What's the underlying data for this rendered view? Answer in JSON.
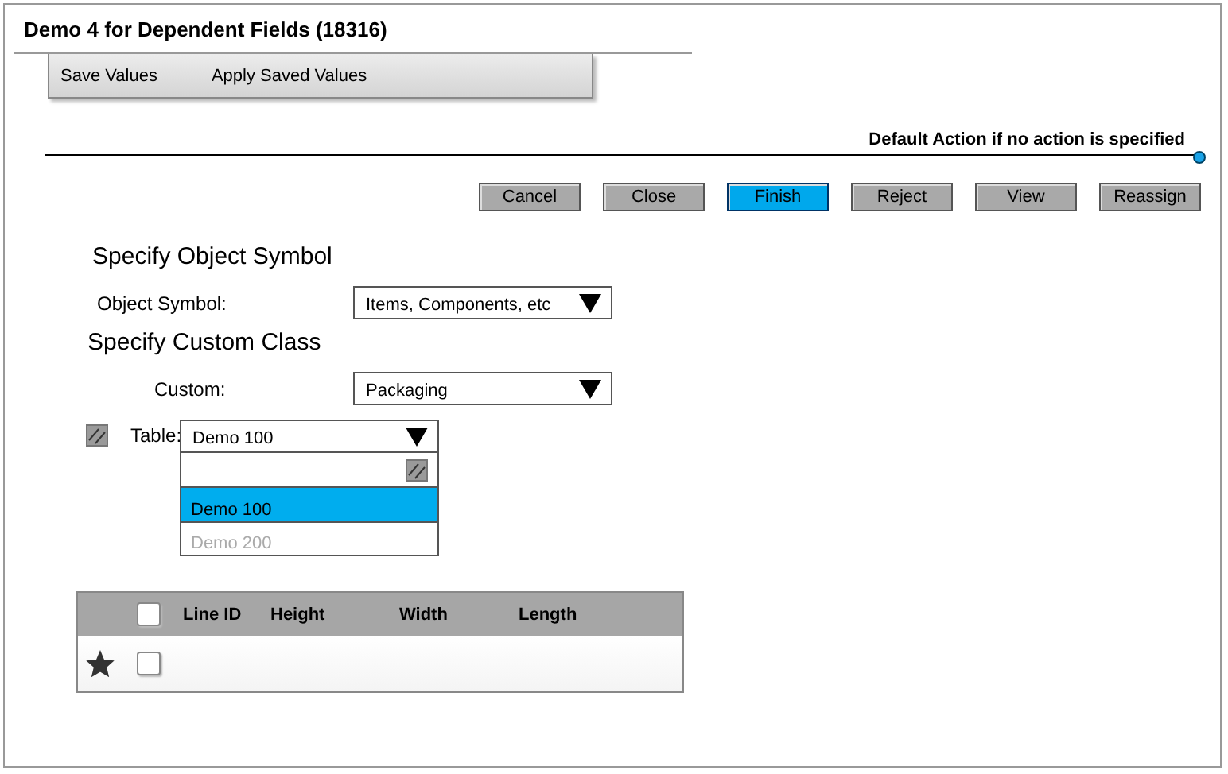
{
  "window": {
    "title": "Demo 4 for Dependent Fields (18316)"
  },
  "menu": [
    "Save Values",
    "Apply Saved Values"
  ],
  "default_action": {
    "label": "Default Action if no action is specified"
  },
  "buttons": [
    {
      "label": "Cancel",
      "selected": false
    },
    {
      "label": "Close",
      "selected": false
    },
    {
      "label": "Finish",
      "selected": true
    },
    {
      "label": "Reject",
      "selected": false
    },
    {
      "label": "View",
      "selected": false
    },
    {
      "label": "Reassign",
      "selected": false
    }
  ],
  "sections": [
    {
      "heading": "Specify Object Symbol",
      "field": {
        "label": "Object Symbol:",
        "value": "Items, Components, etc"
      }
    },
    {
      "heading": "Specify Custom Class",
      "field": {
        "label": "Custom:",
        "value": "Packaging"
      }
    }
  ],
  "table_field": {
    "label": "Table:",
    "value": "Demo 100",
    "expanded": true,
    "options": [
      {
        "label": "Demo 100",
        "selected": true,
        "disabled": false
      },
      {
        "label": "Demo 200",
        "selected": false,
        "disabled": true
      }
    ]
  },
  "grid": {
    "columns": [
      "Line ID",
      "Height",
      "Width",
      "Length"
    ],
    "header_checked": false,
    "rows": [
      {
        "starred": true,
        "checked": false
      }
    ]
  }
}
